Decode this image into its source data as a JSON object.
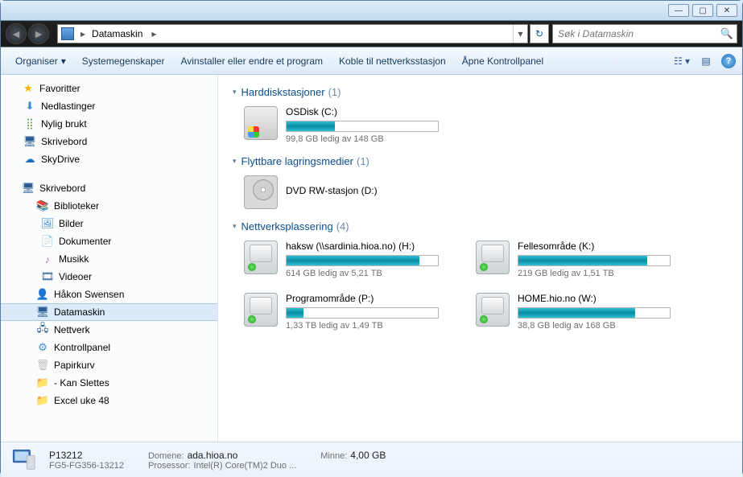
{
  "window": {
    "min": "—",
    "max": "▢",
    "close": "✕"
  },
  "addressbar": {
    "root_arrow": "▸",
    "location": "Datamaskin",
    "sep": "▸"
  },
  "search": {
    "placeholder": "Søk i Datamaskin"
  },
  "toolbar": {
    "organize": "Organiser",
    "organize_arrow": "▾",
    "sysprops": "Systemegenskaper",
    "uninstall": "Avinstaller eller endre et program",
    "mapnet": "Koble til nettverksstasjon",
    "controlpanel": "Åpne Kontrollpanel"
  },
  "sidebar": {
    "favorites": "Favoritter",
    "downloads": "Nedlastinger",
    "recent": "Nylig brukt",
    "desktop": "Skrivebord",
    "skydrive": "SkyDrive",
    "desktop2": "Skrivebord",
    "libraries": "Biblioteker",
    "pictures": "Bilder",
    "documents": "Dokumenter",
    "music": "Musikk",
    "videos": "Videoer",
    "user": "Håkon Swensen",
    "computer": "Datamaskin",
    "network": "Nettverk",
    "controlpanel": "Kontrollpanel",
    "recycle": "Papirkurv",
    "canDelete": "- Kan Slettes",
    "excel": "Excel uke 48"
  },
  "groups": {
    "hdd": {
      "label": "Harddiskstasjoner",
      "count": "(1)"
    },
    "removable": {
      "label": "Flyttbare lagringsmedier",
      "count": "(1)"
    },
    "network": {
      "label": "Nettverksplassering",
      "count": "(4)"
    }
  },
  "drives": {
    "osdisk": {
      "name": "OSDisk (C:)",
      "sub": "99,8 GB ledig av 148 GB",
      "fillpct": "32%"
    },
    "dvd": {
      "name": "DVD RW-stasjon (D:)"
    },
    "haksw": {
      "name": "haksw (\\\\sardinia.hioa.no) (H:)",
      "sub": "614 GB ledig av 5,21 TB",
      "fillpct": "88%"
    },
    "felles": {
      "name": "Fellesområde (K:)",
      "sub": "219 GB ledig av 1,51 TB",
      "fillpct": "85%"
    },
    "program": {
      "name": "Programområde (P:)",
      "sub": "1,33 TB ledig av 1,49 TB",
      "fillpct": "11%"
    },
    "home": {
      "name": "HOME.hio.no (W:)",
      "sub": "38,8 GB ledig av 168 GB",
      "fillpct": "77%"
    }
  },
  "status": {
    "name": "P13212",
    "name2": "FG5-FG356-13212",
    "domain_label": "Domene:",
    "domain": "ada.hioa.no",
    "cpu_label": "Prosessor:",
    "cpu": "Intel(R) Core(TM)2 Duo ...",
    "mem_label": "Minne:",
    "mem": "4,00 GB"
  }
}
